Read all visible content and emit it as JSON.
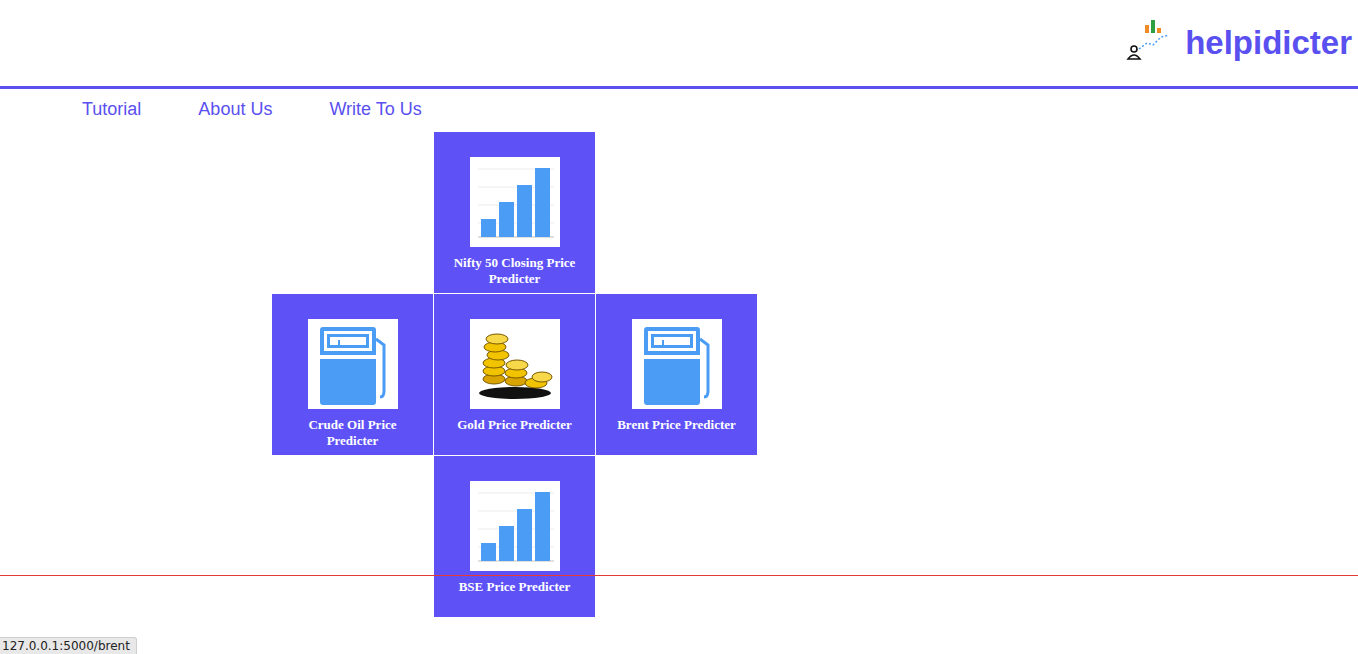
{
  "brand": {
    "name": "helpidicter"
  },
  "nav": [
    {
      "label": "Tutorial"
    },
    {
      "label": "About Us"
    },
    {
      "label": "Write To Us"
    }
  ],
  "tiles": [
    {
      "title": "Nifty 50 Closing Price Predicter",
      "kind": "chart",
      "area": "top"
    },
    {
      "title": "Crude Oil Price Predicter",
      "kind": "pump",
      "area": "left"
    },
    {
      "title": "Gold Price Predicter",
      "kind": "gold",
      "area": "center"
    },
    {
      "title": "Brent Price Predicter",
      "kind": "pump",
      "area": "right"
    },
    {
      "title": "BSE Price Predicter",
      "kind": "chart",
      "area": "bottom"
    }
  ],
  "status_bar": {
    "url": "127.0.0.1:5000/brent"
  }
}
